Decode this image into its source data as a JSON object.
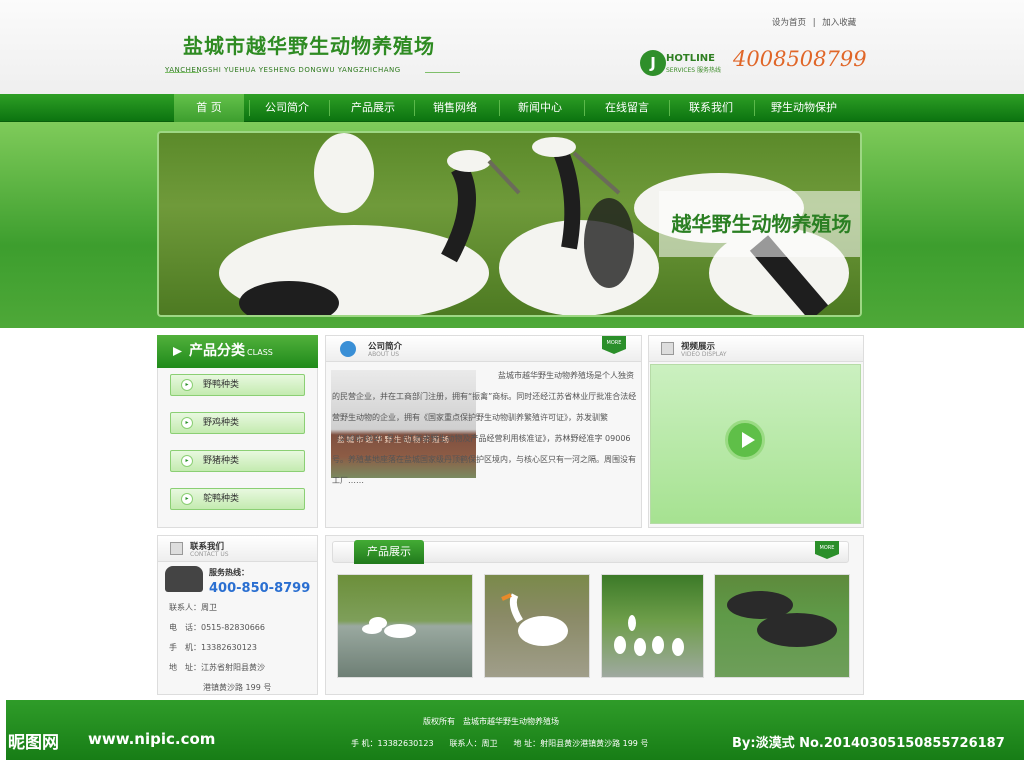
{
  "header": {
    "logo_cn": "盐城市越华野生动物养殖场",
    "logo_en": "YANCHENGSHI YUEHUA YESHENG DONGWU YANGZHICHANG",
    "set_home": "设为首页",
    "add_fav": "加入收藏",
    "divider": "|",
    "hotline_label": "HOTLINE",
    "hotline_sub": "SERVICES 服务热线",
    "phone": "4008508799"
  },
  "nav": {
    "items": [
      "首 页",
      "公司简介",
      "产品展示",
      "销售网络",
      "新闻中心",
      "在线留言",
      "联系我们",
      "野生动物保护"
    ],
    "active": 0
  },
  "banner": {
    "caption": "越华野生动物养殖场"
  },
  "category": {
    "title": "产品分类",
    "sub": "CLASS",
    "items": [
      "野鸭种类",
      "野鸡种类",
      "野猪种类",
      "鸵鸭种类"
    ]
  },
  "about": {
    "title": "公司简介",
    "sub": "ABOUT US",
    "more": "MORE",
    "sign": "盐城市越华野生动物养殖场",
    "text": "盐城市越华野生动物养殖场是个人独资的民营企业，并在工商部门注册，拥有“振禽”商标。同时还经江苏省林业厅批准合法经营野生动物的企业，拥有《国家重点保护野生动物驯养繁殖许可证》，苏发驯繁（2008-019）号；《江苏省野生动物及产品经营利用核准证》，苏林野经准字 09006 号。养殖基地座落在盐城国家级丹顶鹤保护区境内，与核心区只有一河之隔。周围没有工厂……"
  },
  "video": {
    "title": "视频展示",
    "sub": "VIDEO DISPLAY"
  },
  "contact": {
    "title": "联系我们",
    "sub": "CONTACT US",
    "hotline_label": "服务热线：",
    "hotline": "400-850-8799",
    "person": "联系人：周卫",
    "tel": "电　话：0515-82830666",
    "mobile": "手　机：13382630123",
    "addr1": "地　址：江苏省射阳县黄沙",
    "addr2": "港镇黄沙路 199 号"
  },
  "products": {
    "title": "产品展示",
    "more": "MORE",
    "items": [
      "white-geese-on-water",
      "white-goose-on-grass",
      "geese-flock-on-lawn",
      "wild-boars-on-grass"
    ]
  },
  "footer": {
    "copyright": "版权所有　盐城市越华野生动物养殖场",
    "info": "手 机：13382630123　　联系人：周卫　　地 址：射阳县黄沙港镇黄沙路 199 号"
  },
  "watermark": {
    "logo": "昵图网",
    "site": "www.nipic.com",
    "credit": "By:淡漠式 No.20140305150855726187"
  }
}
